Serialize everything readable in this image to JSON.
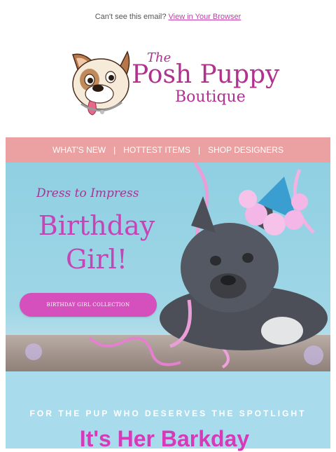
{
  "preheader": {
    "text": "Can't see this email?",
    "link": "View in Your Browser"
  },
  "logo": {
    "the": "The",
    "main": "Posh Puppy",
    "sub": "Boutique",
    "alt": "The Posh Puppy Boutique"
  },
  "nav": {
    "items": [
      "WHAT'S NEW",
      "HOTTEST ITEMS",
      "SHOP DESIGNERS"
    ],
    "separator": "|"
  },
  "hero": {
    "tagline": "Dress to Impress",
    "title_line1": "Birthday",
    "title_line2": "Girl!",
    "cta": "BIRTHDAY GIRL COLLECTION"
  },
  "promo": {
    "eyebrow": "FOR THE PUP WHO DESERVES THE SPOTLIGHT",
    "headline": "It's Her Barkday"
  },
  "colors": {
    "brand_pink": "#b0318e",
    "nav_bg": "#eba1a1",
    "hero_bg": "#8fd0e2",
    "cta_bg": "#d54fbd",
    "promo_bg": "#a8dcec",
    "headline": "#d63ab8"
  }
}
